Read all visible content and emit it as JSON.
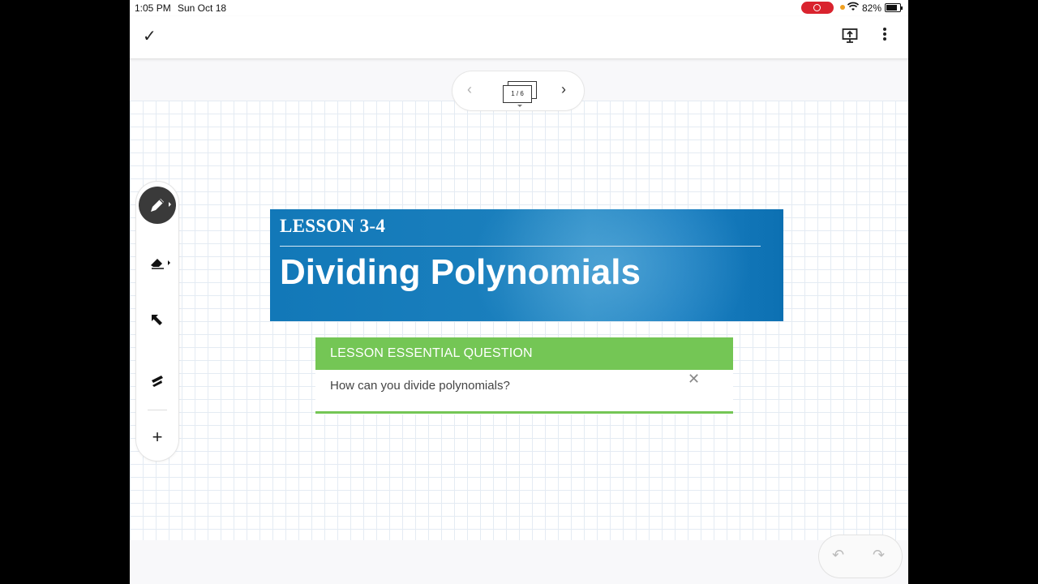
{
  "status_bar": {
    "time": "1:05 PM",
    "date": "Sun Oct 18",
    "battery_percent": "82%",
    "recording_color": "#d9232e"
  },
  "top_bar": {
    "done_icon": "checkmark-icon",
    "present_icon": "present-screen-icon",
    "more_icon": "more-vertical-icon"
  },
  "pager": {
    "page_indicator": "1 / 6",
    "prev_icon": "chevron-left-icon",
    "next_icon": "chevron-right-icon"
  },
  "toolbar": {
    "tools": [
      "pen-icon",
      "eraser-icon",
      "select-arrow-icon",
      "laser-pointer-icon"
    ],
    "add_icon": "plus-icon",
    "active_tool": "pen-icon"
  },
  "slide": {
    "lesson_label": "LESSON 3-4",
    "title": "Dividing Polynomials",
    "header_color": "#1278b8",
    "essential_question": {
      "label": "LESSON ESSENTIAL QUESTION",
      "question": "How can you divide polynomials?",
      "accent_color": "#74c655"
    }
  },
  "history": {
    "undo_icon": "undo-icon",
    "redo_icon": "redo-icon"
  }
}
